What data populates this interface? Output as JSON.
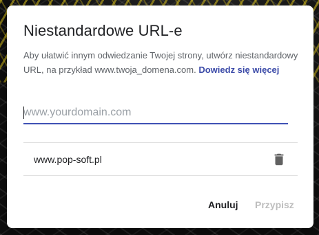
{
  "dialog": {
    "title": "Niestandardowe URL-e",
    "description": "Aby ułatwić innym odwiedzanie Twojej strony, utwórz niestandardowy URL, na przykład www.twoja_domena.com. ",
    "learn_more_link": "Dowiedz się więcej",
    "input": {
      "placeholder": "www.yourdomain.com",
      "value": ""
    },
    "urls": [
      {
        "url": "www.pop-soft.pl",
        "action_icon": "trash-icon"
      }
    ],
    "buttons": {
      "cancel": "Anuluj",
      "assign": "Przypisz"
    }
  },
  "colors": {
    "accent": "#3f51b5",
    "link": "#3b4aa8",
    "disabled_text": "#bdbdbd",
    "backdrop": "#141414"
  }
}
